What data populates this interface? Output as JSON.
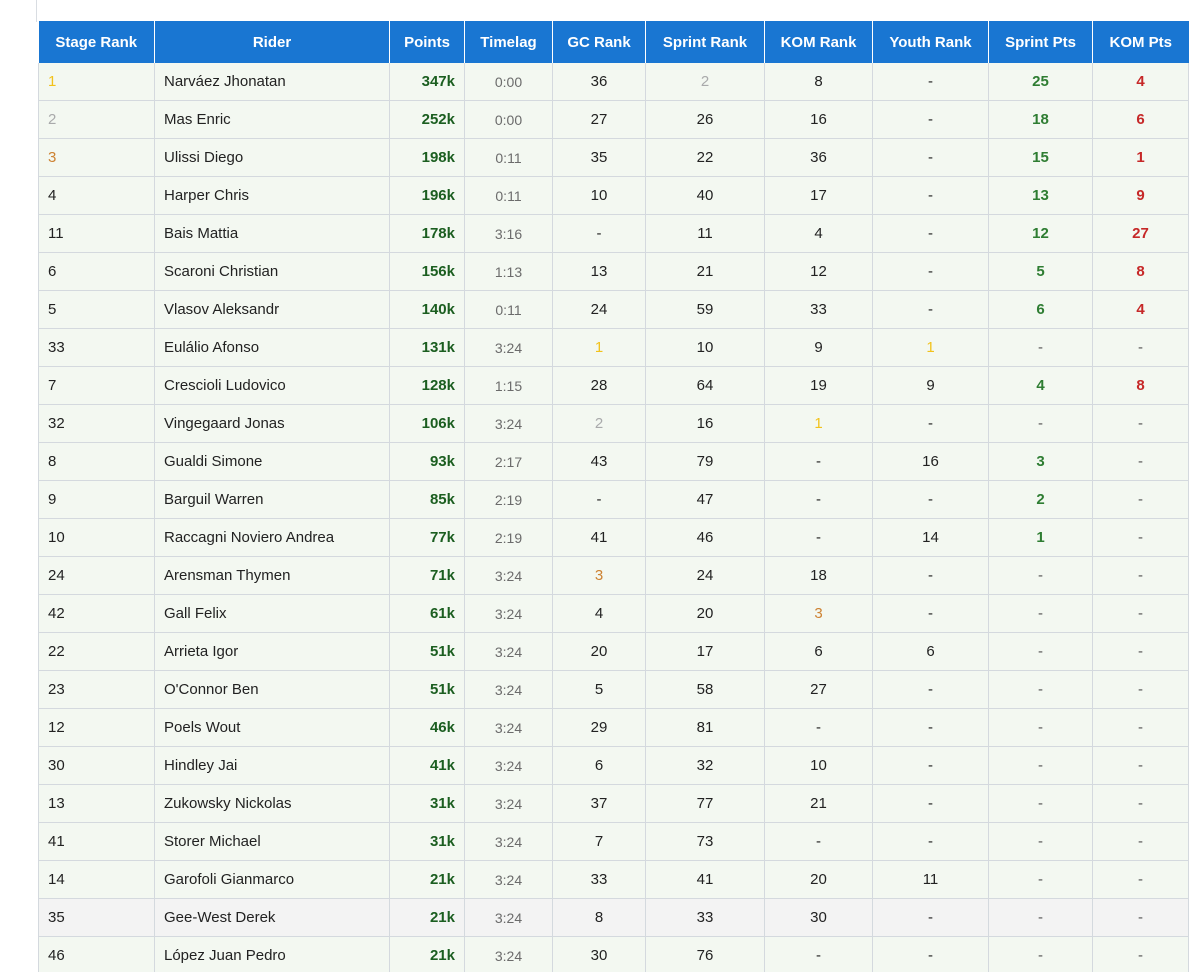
{
  "table": {
    "columns": [
      "Stage Rank",
      "Rider",
      "Points",
      "Timelag",
      "GC Rank",
      "Sprint Rank",
      "KOM Rank",
      "Youth Rank",
      "Sprint Pts",
      "KOM Pts"
    ],
    "colors": {
      "header_bg": "#1976d2",
      "points": "#1b5e20",
      "sprint_pts": "#2e7d32",
      "kom_pts": "#c62828",
      "gold": "#f2c21b",
      "silver": "#a9aaab",
      "bronze": "#cd8232"
    },
    "rows": [
      [
        "1",
        "Narváez Jhonatan",
        "347k",
        "0:00",
        "36",
        "2",
        "8",
        "-",
        "25",
        "4"
      ],
      [
        "2",
        "Mas Enric",
        "252k",
        "0:00",
        "27",
        "26",
        "16",
        "-",
        "18",
        "6"
      ],
      [
        "3",
        "Ulissi Diego",
        "198k",
        "0:11",
        "35",
        "22",
        "36",
        "-",
        "15",
        "1"
      ],
      [
        "4",
        "Harper Chris",
        "196k",
        "0:11",
        "10",
        "40",
        "17",
        "-",
        "13",
        "9"
      ],
      [
        "11",
        "Bais Mattia",
        "178k",
        "3:16",
        "-",
        "11",
        "4",
        "-",
        "12",
        "27"
      ],
      [
        "6",
        "Scaroni Christian",
        "156k",
        "1:13",
        "13",
        "21",
        "12",
        "-",
        "5",
        "8"
      ],
      [
        "5",
        "Vlasov Aleksandr",
        "140k",
        "0:11",
        "24",
        "59",
        "33",
        "-",
        "6",
        "4"
      ],
      [
        "33",
        "Eulálio Afonso",
        "131k",
        "3:24",
        "1",
        "10",
        "9",
        "1",
        "-",
        "-"
      ],
      [
        "7",
        "Crescioli Ludovico",
        "128k",
        "1:15",
        "28",
        "64",
        "19",
        "9",
        "4",
        "8"
      ],
      [
        "32",
        "Vingegaard Jonas",
        "106k",
        "3:24",
        "2",
        "16",
        "1",
        "-",
        "-",
        "-"
      ],
      [
        "8",
        "Gualdi Simone",
        "93k",
        "2:17",
        "43",
        "79",
        "-",
        "16",
        "3",
        "-"
      ],
      [
        "9",
        "Barguil Warren",
        "85k",
        "2:19",
        "-",
        "47",
        "-",
        "-",
        "2",
        "-"
      ],
      [
        "10",
        "Raccagni Noviero Andrea",
        "77k",
        "2:19",
        "41",
        "46",
        "-",
        "14",
        "1",
        "-"
      ],
      [
        "24",
        "Arensman Thymen",
        "71k",
        "3:24",
        "3",
        "24",
        "18",
        "-",
        "-",
        "-"
      ],
      [
        "42",
        "Gall Felix",
        "61k",
        "3:24",
        "4",
        "20",
        "3",
        "-",
        "-",
        "-"
      ],
      [
        "22",
        "Arrieta Igor",
        "51k",
        "3:24",
        "20",
        "17",
        "6",
        "6",
        "-",
        "-"
      ],
      [
        "23",
        "O'Connor Ben",
        "51k",
        "3:24",
        "5",
        "58",
        "27",
        "-",
        "-",
        "-"
      ],
      [
        "12",
        "Poels Wout",
        "46k",
        "3:24",
        "29",
        "81",
        "-",
        "-",
        "-",
        "-"
      ],
      [
        "30",
        "Hindley Jai",
        "41k",
        "3:24",
        "6",
        "32",
        "10",
        "-",
        "-",
        "-"
      ],
      [
        "13",
        "Zukowsky Nickolas",
        "31k",
        "3:24",
        "37",
        "77",
        "21",
        "-",
        "-",
        "-"
      ],
      [
        "41",
        "Storer Michael",
        "31k",
        "3:24",
        "7",
        "73",
        "-",
        "-",
        "-",
        "-"
      ],
      [
        "14",
        "Garofoli Gianmarco",
        "21k",
        "3:24",
        "33",
        "41",
        "20",
        "11",
        "-",
        "-"
      ],
      [
        "35",
        "Gee-West Derek",
        "21k",
        "3:24",
        "8",
        "33",
        "30",
        "-",
        "-",
        "-"
      ],
      [
        "46",
        "López Juan Pedro",
        "21k",
        "3:24",
        "30",
        "76",
        "-",
        "-",
        "-",
        "-"
      ]
    ]
  }
}
